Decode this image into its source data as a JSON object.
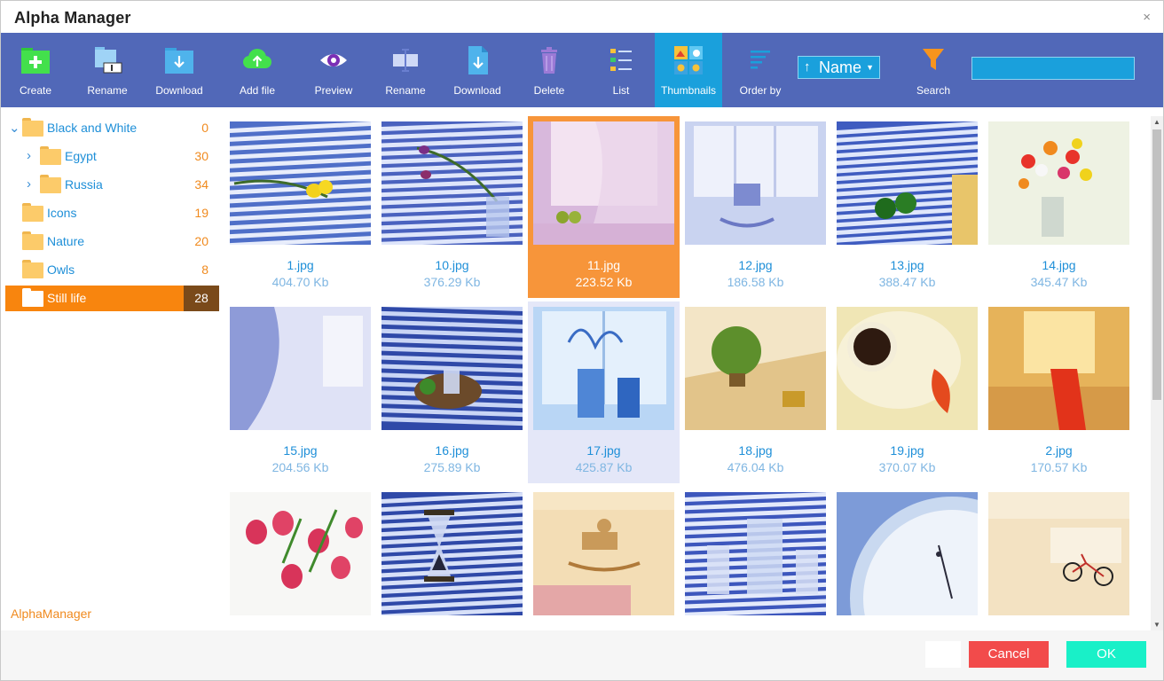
{
  "window": {
    "title": "Alpha Manager",
    "close_glyph": "×"
  },
  "toolbar": {
    "buttons": [
      {
        "label": "Create",
        "icon": "create-folder-icon"
      },
      {
        "label": "Rename",
        "icon": "rename-folder-icon"
      },
      {
        "label": "Download",
        "icon": "download-folder-icon"
      },
      {
        "label": "Add file",
        "icon": "upload-cloud-icon"
      },
      {
        "label": "Preview",
        "icon": "eye-icon"
      },
      {
        "label": "Rename",
        "icon": "rename-file-icon"
      },
      {
        "label": "Download",
        "icon": "download-file-icon"
      },
      {
        "label": "Delete",
        "icon": "trash-icon"
      },
      {
        "label": "List",
        "icon": "list-icon"
      },
      {
        "label": "Thumbnails",
        "icon": "thumbnails-icon",
        "active": true
      },
      {
        "label": "Order by",
        "icon": "order-lines-icon"
      },
      {
        "label": "Search",
        "icon": "filter-funnel-icon"
      }
    ],
    "order": {
      "direction_glyph": "↑",
      "value": "Name",
      "caret": "▼"
    },
    "search": {
      "value": ""
    }
  },
  "sidebar": {
    "items": [
      {
        "name": "Black and White",
        "count": "0",
        "level": 0,
        "expander": "expanded"
      },
      {
        "name": "Egypt",
        "count": "30",
        "level": 1,
        "expander": "collapsed"
      },
      {
        "name": "Russia",
        "count": "34",
        "level": 1,
        "expander": "collapsed"
      },
      {
        "name": "Icons",
        "count": "19",
        "level": 0,
        "expander": "none"
      },
      {
        "name": "Nature",
        "count": "20",
        "level": 0,
        "expander": "none"
      },
      {
        "name": "Owls",
        "count": "8",
        "level": 0,
        "expander": "none"
      },
      {
        "name": "Still life",
        "count": "28",
        "level": 0,
        "expander": "none",
        "selected": true
      }
    ],
    "brand": "AlphaManager"
  },
  "files": [
    {
      "name": "1.jpg",
      "size": "404.70 Kb",
      "scene": "blinds-tulips-yellow"
    },
    {
      "name": "10.jpg",
      "size": "376.29 Kb",
      "scene": "blinds-tulips-vase"
    },
    {
      "name": "11.jpg",
      "size": "223.52 Kb",
      "scene": "curtain-apples",
      "state": "selected"
    },
    {
      "name": "12.jpg",
      "size": "186.58 Kb",
      "scene": "rocking-horse-window"
    },
    {
      "name": "13.jpg",
      "size": "388.47 Kb",
      "scene": "blinds-green-apples"
    },
    {
      "name": "14.jpg",
      "size": "345.47 Kb",
      "scene": "flower-bouquet"
    },
    {
      "name": "15.jpg",
      "size": "204.56 Kb",
      "scene": "curtain-light"
    },
    {
      "name": "16.jpg",
      "size": "275.89 Kb",
      "scene": "blinds-tray-glass"
    },
    {
      "name": "17.jpg",
      "size": "425.87 Kb",
      "scene": "blue-vase-window",
      "state": "hover"
    },
    {
      "name": "18.jpg",
      "size": "476.04 Kb",
      "scene": "potted-plant-wood"
    },
    {
      "name": "19.jpg",
      "size": "370.07 Kb",
      "scene": "coffee-cup-leaf"
    },
    {
      "name": "2.jpg",
      "size": "170.57 Kb",
      "scene": "warm-window-red"
    },
    {
      "name": "",
      "size": "",
      "scene": "pink-tulips"
    },
    {
      "name": "",
      "size": "",
      "scene": "hourglass-blinds"
    },
    {
      "name": "",
      "size": "",
      "scene": "rocking-horse-rug"
    },
    {
      "name": "",
      "size": "",
      "scene": "glass-pitcher-blinds"
    },
    {
      "name": "",
      "size": "",
      "scene": "clock-face"
    },
    {
      "name": "",
      "size": "",
      "scene": "toy-bicycle"
    }
  ],
  "footer": {
    "cancel_label": "Cancel",
    "ok_label": "OK"
  },
  "colors": {
    "toolbar": "#5168b8",
    "active": "#1aa0dc",
    "selected": "#f7953a",
    "hover": "#e4e7f8",
    "link": "#1e8fd8",
    "count": "#f08a1e",
    "cancel": "#f24b4b",
    "ok": "#19f0c8"
  }
}
